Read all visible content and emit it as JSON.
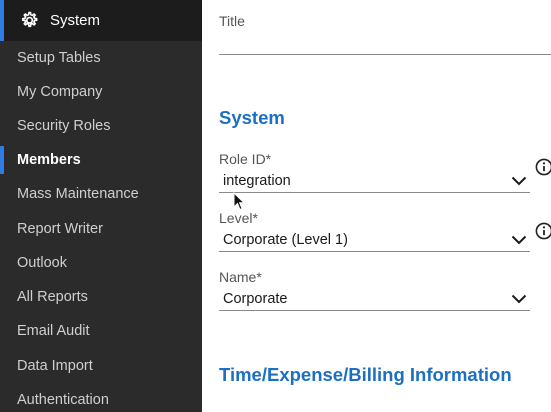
{
  "sidebar": {
    "header_label": "System",
    "items": [
      {
        "label": "Setup Tables",
        "active": false
      },
      {
        "label": "My Company",
        "active": false
      },
      {
        "label": "Security Roles",
        "active": false
      },
      {
        "label": "Members",
        "active": true
      },
      {
        "label": "Mass Maintenance",
        "active": false
      },
      {
        "label": "Report Writer",
        "active": false
      },
      {
        "label": "Outlook",
        "active": false
      },
      {
        "label": "All Reports",
        "active": false
      },
      {
        "label": "Email Audit",
        "active": false
      },
      {
        "label": "Data Import",
        "active": false
      },
      {
        "label": "Authentication",
        "active": false
      }
    ]
  },
  "form": {
    "title_label": "Title",
    "title_value": "",
    "system_section": "System",
    "role_id": {
      "label": "Role ID*",
      "value": "integration"
    },
    "level": {
      "label": "Level*",
      "value": "Corporate (Level 1)"
    },
    "name": {
      "label": "Name*",
      "value": "Corporate"
    },
    "billing_section": "Time/Expense/Billing Information"
  },
  "colors": {
    "sidebar_bg": "#2b2b2b",
    "accent": "#2f7de1",
    "section_title": "#1d6fc4"
  },
  "icons": {
    "header": "gear-icon",
    "dropdown": "chevron-down-icon",
    "info": "info-icon"
  }
}
